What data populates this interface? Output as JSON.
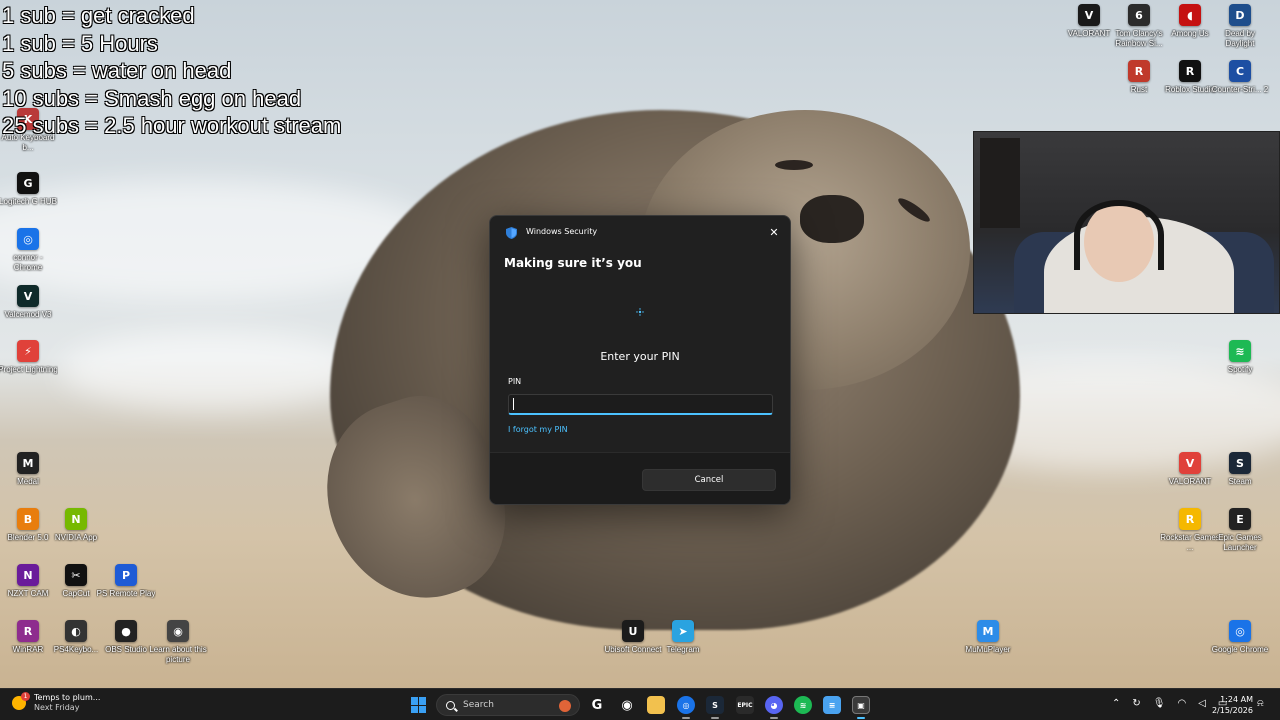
{
  "overlay": {
    "lines": [
      "1 sub = get cracked",
      "1 sub = 5 Hours",
      "5 subs = water on head",
      "10 subs = Smash egg on head",
      "25 subs = 2.5 hour workout stream"
    ]
  },
  "desktop": {
    "icons_left": [
      {
        "label": "Auto Keyboard b...",
        "icon": "keyboard-icon",
        "color": "#b93a3a",
        "glyph": "K"
      },
      {
        "label": "Logitech G HUB",
        "icon": "logitech-icon",
        "color": "#111111",
        "glyph": "G"
      },
      {
        "label": "connor - Chrome",
        "icon": "chrome-icon",
        "color": "#1a73e8",
        "glyph": "◎"
      },
      {
        "label": "Valcemod V3",
        "icon": "valcemod-icon",
        "color": "#0f2a2a",
        "glyph": "V"
      },
      {
        "label": "Project Lightning",
        "icon": "lightning-icon",
        "color": "#e0413a",
        "glyph": "⚡"
      },
      {
        "label": "Medal",
        "icon": "medal-icon",
        "color": "#222222",
        "glyph": "M"
      },
      {
        "label": "Blender 5.0",
        "icon": "blender-icon",
        "color": "#e87d0d",
        "glyph": "B"
      },
      {
        "label": "NVIDIA App",
        "icon": "nvidia-icon",
        "color": "#76b900",
        "glyph": "N"
      },
      {
        "label": "NZXT CAM",
        "icon": "nzxt-icon",
        "color": "#6a1b9a",
        "glyph": "N"
      },
      {
        "label": "CapCut",
        "icon": "capcut-icon",
        "color": "#111111",
        "glyph": "✂"
      },
      {
        "label": "PS Remote Play",
        "icon": "ps-remote-icon",
        "color": "#1e5bd6",
        "glyph": "P"
      },
      {
        "label": "WinRAR",
        "icon": "winrar-icon",
        "color": "#8e2c8e",
        "glyph": "R"
      },
      {
        "label": "PS4Keybo...",
        "icon": "gamepad-icon",
        "color": "#333333",
        "glyph": "◐"
      },
      {
        "label": "OBS Studio",
        "icon": "obs-icon",
        "color": "#222222",
        "glyph": "●"
      },
      {
        "label": "Learn about this picture",
        "icon": "camera-icon",
        "color": "#444444",
        "glyph": "◉"
      }
    ],
    "icons_bottom": [
      {
        "label": "Ubisoft Connect",
        "icon": "ubisoft-icon",
        "color": "#1b1b1b",
        "glyph": "U"
      },
      {
        "label": "Telegram",
        "icon": "telegram-icon",
        "color": "#2aa3e0",
        "glyph": "➤"
      },
      {
        "label": "MuMuPlayer",
        "icon": "mumu-icon",
        "color": "#2d8ce8",
        "glyph": "M"
      }
    ],
    "icons_right": [
      {
        "label": "VALORANT",
        "icon": "valorant-icon",
        "color": "#1a1a1a",
        "glyph": "V"
      },
      {
        "label": "Tom Clancy's Rainbow Si...",
        "icon": "rainbow-six-icon",
        "color": "#2b2b2b",
        "glyph": "6"
      },
      {
        "label": "Among Us",
        "icon": "among-us-icon",
        "color": "#c51111",
        "glyph": "◖"
      },
      {
        "label": "Dead by Daylight",
        "icon": "dbd-icon",
        "color": "#1e4e8c",
        "glyph": "D"
      },
      {
        "label": "Rust",
        "icon": "rust-icon",
        "color": "#c0392b",
        "glyph": "R"
      },
      {
        "label": "Roblox Studio",
        "icon": "roblox-icon",
        "color": "#111111",
        "glyph": "R"
      },
      {
        "label": "Counter-Stri... 2",
        "icon": "cs2-icon",
        "color": "#1d4fa3",
        "glyph": "C"
      },
      {
        "label": "Spotify",
        "icon": "spotify-icon",
        "color": "#1db954",
        "glyph": "≋"
      },
      {
        "label": "VALORANT",
        "icon": "valorant-icon",
        "color": "#e0413a",
        "glyph": "V"
      },
      {
        "label": "Steam",
        "icon": "steam-icon",
        "color": "#1b2838",
        "glyph": "S"
      },
      {
        "label": "Rockstar Games ...",
        "icon": "rockstar-icon",
        "color": "#f5b800",
        "glyph": "R"
      },
      {
        "label": "Epic Games Launcher",
        "icon": "epic-icon",
        "color": "#222222",
        "glyph": "E"
      },
      {
        "label": "Google Chrome",
        "icon": "chrome-icon",
        "color": "#1a73e8",
        "glyph": "◎"
      }
    ]
  },
  "dialog": {
    "app_name": "Windows Security",
    "heading": "Making sure it’s you",
    "prompt": "Enter your PIN",
    "pin_label": "PIN",
    "pin_value": "",
    "forgot_link": "I forgot my PIN",
    "cancel_label": "Cancel",
    "accent": "#4cc2ff"
  },
  "taskbar": {
    "weather_title": "Temps to plum...",
    "weather_sub": "Next Friday",
    "weather_badge": "1",
    "search_placeholder": "Search",
    "time": "1:24 AM",
    "date": "2/15/2026"
  }
}
